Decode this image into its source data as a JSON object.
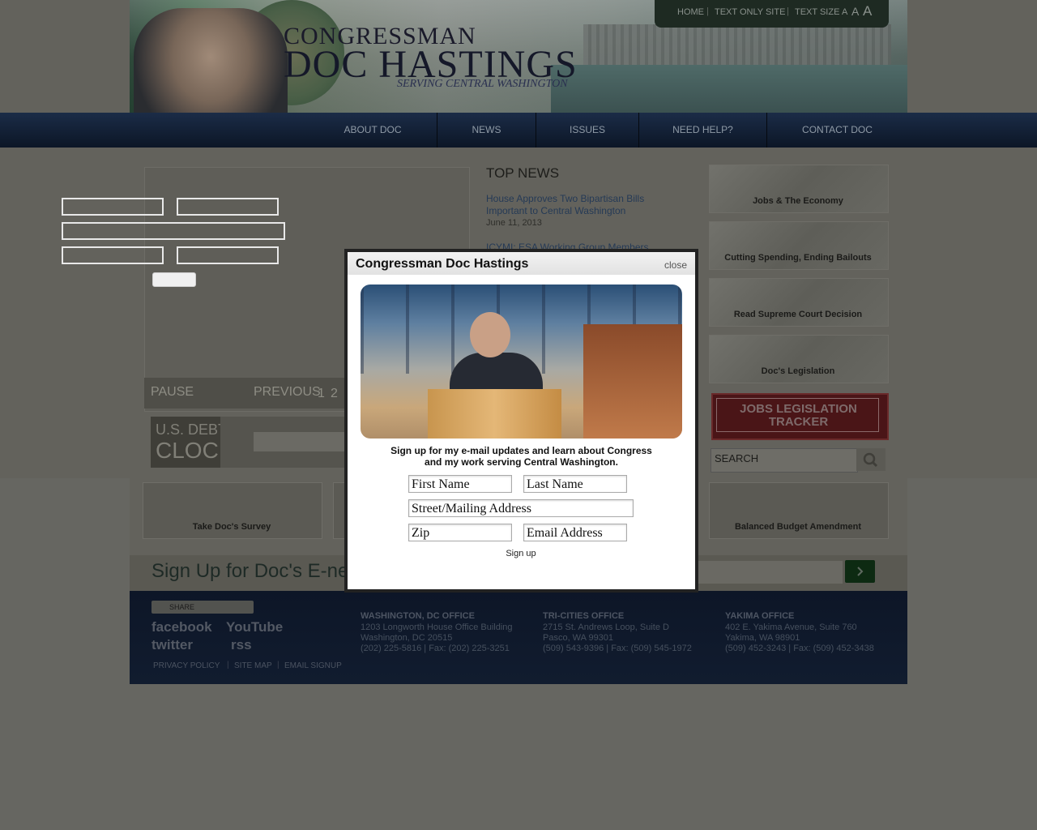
{
  "header": {
    "title_line1": "CONGRESSMAN",
    "title_line2": "DOC HASTINGS",
    "tagline": "SERVING CENTRAL WASHINGTON",
    "utility": {
      "home": "HOME",
      "text_only": "TEXT ONLY SITE",
      "text_size": "TEXT SIZE",
      "size_small": "A",
      "size_medium": "A",
      "size_large": "A"
    }
  },
  "nav": {
    "items": [
      "ABOUT DOC",
      "NEWS",
      "ISSUES",
      "NEED HELP?",
      "CONTACT DOC"
    ]
  },
  "slider": {
    "pause": "PAUSE",
    "previous": "PREVIOUS",
    "pages": [
      "1",
      "2"
    ]
  },
  "debt_clock": {
    "line1": "U.S. DEBT",
    "line2": "CLOCK"
  },
  "top_news": {
    "heading": "TOP NEWS",
    "items": [
      {
        "title_line1": "House Approves Two Bipartisan Bills",
        "title_line2": "Important to Central Washington",
        "date": "June 11, 2013"
      },
      {
        "title_line1": "ICYMI: ESA Working Group Members",
        "title_line2": "",
        "date": ""
      }
    ]
  },
  "sidebar": {
    "tiles": [
      "Jobs & The Economy",
      "Cutting Spending, Ending Bailouts",
      "Read Supreme Court Decision",
      "Doc's Legislation"
    ],
    "jobs_tracker": {
      "line1": "JOBS LEGISLATION",
      "line2": "TRACKER"
    },
    "search_placeholder": "SEARCH"
  },
  "lower_tiles": {
    "survey": "Take Doc's Survey",
    "balanced": "Balanced Budget Amendment"
  },
  "enews": {
    "heading": "Sign Up for Doc's E-new"
  },
  "footer": {
    "share": "SHARE",
    "social": {
      "facebook": "facebook",
      "youtube": "YouTube",
      "twitter": "twitter",
      "rss": "rss"
    },
    "links": [
      "PRIVACY POLICY",
      "SITE MAP",
      "EMAIL SIGNUP"
    ],
    "offices": [
      {
        "title": "WASHINGTON, DC OFFICE",
        "line1": "1203 Longworth House Office Building",
        "line2": "Washington, DC 20515",
        "line3": "(202) 225-5816 | Fax: (202) 225-3251"
      },
      {
        "title": "TRI-CITIES OFFICE",
        "line1": "2715 St. Andrews Loop, Suite D",
        "line2": "Pasco, WA 99301",
        "line3": "(509) 543-9396 | Fax: (509) 545-1972"
      },
      {
        "title": "YAKIMA OFFICE",
        "line1": "402 E. Yakima Avenue, Suite 760",
        "line2": "Yakima, WA 98901",
        "line3": "(509) 452-3243 | Fax: (509) 452-3438"
      }
    ]
  },
  "modal": {
    "title": "Congressman Doc Hastings",
    "close": "close",
    "copy_line1": "Sign up for my e-mail updates and learn about Congress",
    "copy_line2": "and my work serving Central Washington.",
    "fields": {
      "first_name": "First Name",
      "last_name": "Last Name",
      "address": "Street/Mailing Address",
      "zip": "Zip",
      "email": "Email Address"
    },
    "submit": "Sign up"
  },
  "colors": {
    "nav": "#1b2c47",
    "footer": "#0d1627",
    "jobs_tracker": "#4a1517",
    "enews_go": "#0d2a12"
  }
}
